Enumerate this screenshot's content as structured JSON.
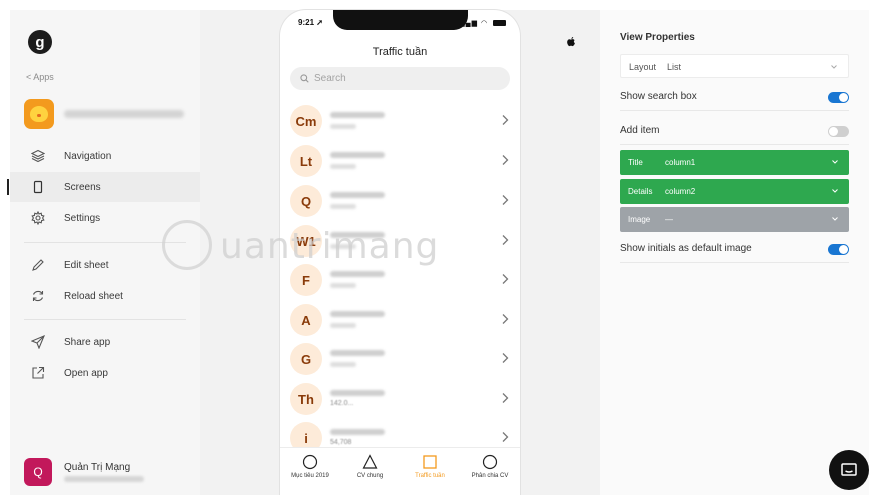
{
  "sidebar": {
    "logo_letter": "g",
    "back_link": "< Apps",
    "nav": [
      {
        "label": "Navigation"
      },
      {
        "label": "Screens"
      },
      {
        "label": "Settings"
      },
      {
        "label": "Edit sheet"
      },
      {
        "label": "Reload sheet"
      },
      {
        "label": "Share app"
      },
      {
        "label": "Open app"
      }
    ],
    "active_item": "Screens",
    "user": {
      "initial": "Q",
      "name": "Quản Trị Mạng"
    }
  },
  "phone": {
    "time": "9:21",
    "title": "Traffic tuần",
    "search_placeholder": "Search",
    "items": [
      {
        "initial": "Cm"
      },
      {
        "initial": "Lt"
      },
      {
        "initial": "Q"
      },
      {
        "initial": "W1"
      },
      {
        "initial": "F"
      },
      {
        "initial": "A"
      },
      {
        "initial": "G"
      },
      {
        "initial": "Th",
        "sub": "142.0..."
      },
      {
        "initial": "i",
        "sub": "54,708"
      }
    ],
    "tabs": [
      {
        "label": "Mục tiêu 2019"
      },
      {
        "label": "CV chung"
      },
      {
        "label": "Traffic tuần"
      },
      {
        "label": "Phân chia CV"
      }
    ],
    "active_tab": "Traffic tuần"
  },
  "watermark": {
    "text": "uantrimang"
  },
  "panel": {
    "title": "View Properties",
    "layout_label": "Layout",
    "layout_value": "List",
    "show_search_label": "Show search box",
    "show_search_on": true,
    "add_item_label": "Add item",
    "add_item_on": false,
    "fields": [
      {
        "key": "Title",
        "value": "column1"
      },
      {
        "key": "Details",
        "value": "column2"
      },
      {
        "key": "Image",
        "value": "—"
      }
    ],
    "show_initials_label": "Show initials as default image",
    "show_initials_on": true
  },
  "colors": {
    "accent": "#1976d2",
    "field_green": "#2ea84f",
    "field_gray": "#9ea3a8",
    "app_orange": "#f39a1e",
    "avatar": "#c2185b",
    "initial_bg": "#fdebd9"
  }
}
